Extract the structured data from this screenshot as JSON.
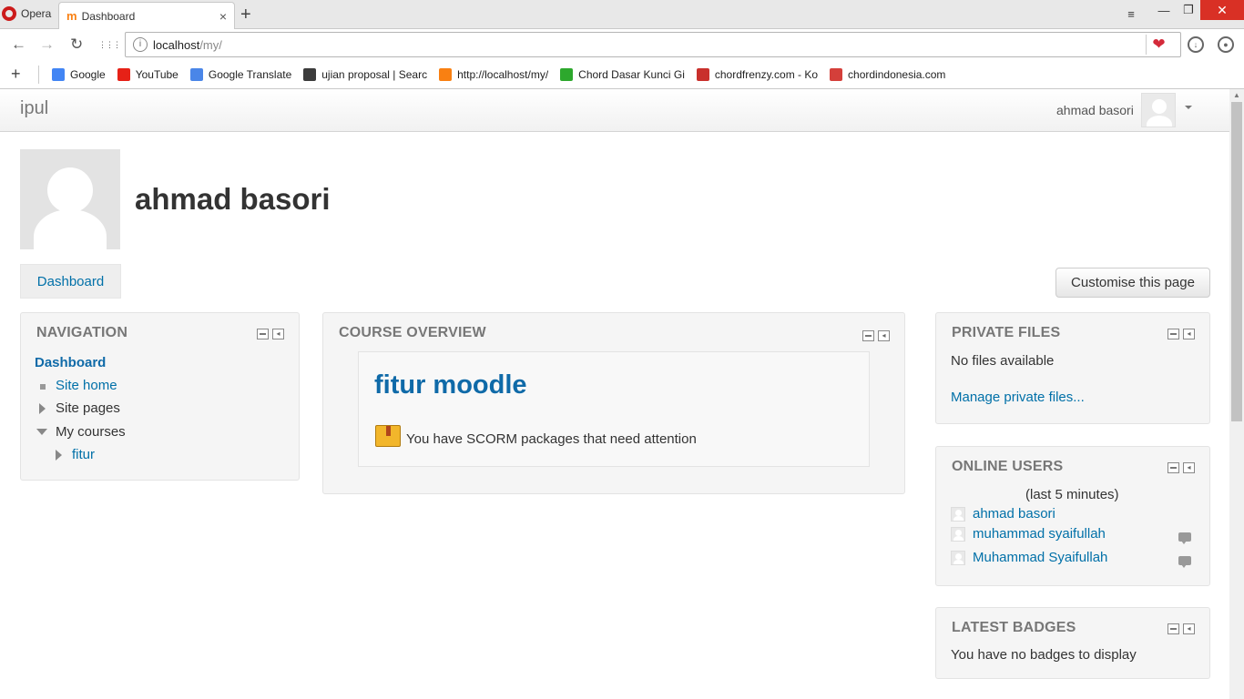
{
  "browser": {
    "menu_label": "Opera",
    "tab_title": "Dashboard",
    "tab_close": "×",
    "new_tab": "+",
    "window_controls": {
      "tab_menu": "≡",
      "minimize": "—",
      "maximize": "❐",
      "close": "✕"
    },
    "nav": {
      "back": "←",
      "forward": "→",
      "reload": "↻",
      "speed_dial": "⋮⋮⋮"
    },
    "url_host": "localhost",
    "url_path": "/my/",
    "heart": "❤",
    "bookmarks_add": "+",
    "bookmarks": [
      {
        "label": "Google",
        "icon": "google-icon",
        "color": "#4285f4"
      },
      {
        "label": "YouTube",
        "icon": "youtube-icon",
        "color": "#e62117"
      },
      {
        "label": "Google Translate",
        "icon": "translate-icon",
        "color": "#4a86e8"
      },
      {
        "label": "ujian proposal | Searc",
        "icon": "scribd-icon",
        "color": "#3c3c3c"
      },
      {
        "label": "http://localhost/my/",
        "icon": "moodle-icon",
        "color": "#f98012"
      },
      {
        "label": "Chord Dasar Kunci Gi",
        "icon": "chord-icon",
        "color": "#2da82d"
      },
      {
        "label": "chordfrenzy.com - Ko",
        "icon": "guitar-icon",
        "color": "#c9302c"
      },
      {
        "label": "chordindonesia.com",
        "icon": "chordindonesia-icon",
        "color": "#d43f3a"
      }
    ]
  },
  "site": {
    "brand": "ipul",
    "user_menu_name": "ahmad basori"
  },
  "header": {
    "user_fullname": "ahmad basori",
    "dashboard_tab": "Dashboard",
    "customise_button": "Customise this page"
  },
  "navigation_block": {
    "title": "NAVIGATION",
    "dashboard": "Dashboard",
    "site_home": "Site home",
    "site_pages": "Site pages",
    "my_courses": "My courses",
    "course": "fitur"
  },
  "course_overview": {
    "title": "COURSE OVERVIEW",
    "course_name": "fitur moodle",
    "notice": "You have SCORM packages that need attention"
  },
  "private_files": {
    "title": "PRIVATE FILES",
    "empty": "No files available",
    "manage_link": "Manage private files..."
  },
  "online_users": {
    "title": "ONLINE USERS",
    "period": "(last 5 minutes)",
    "users": [
      "ahmad basori",
      "muhammad syaifullah",
      "Muhammad Syaifullah"
    ]
  },
  "latest_badges": {
    "title": "LATEST BADGES",
    "empty": "You have no badges to display"
  },
  "colors": {
    "link": "#0070a8",
    "block_title": "#777777",
    "block_bg": "#f5f5f5"
  }
}
